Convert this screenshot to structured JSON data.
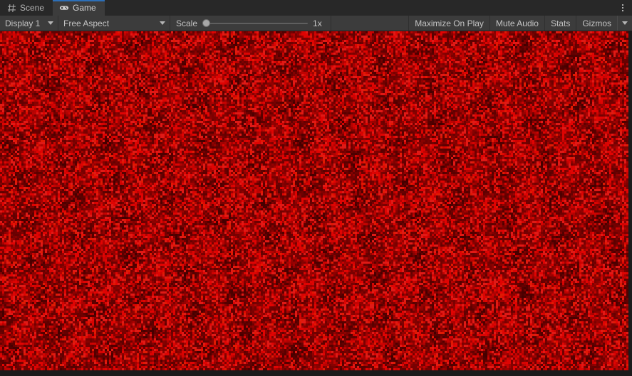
{
  "window": {
    "title": "Game",
    "menu_icon": "kebab-menu-icon"
  },
  "tabs": [
    {
      "label": "Scene",
      "icon": "scene-grid-icon",
      "active": false
    },
    {
      "label": "Game",
      "icon": "gamepad-icon",
      "active": true
    }
  ],
  "toolbar": {
    "display_dropdown": {
      "label": "Display 1",
      "icon": "chevron-down-icon"
    },
    "aspect_dropdown": {
      "label": "Free Aspect",
      "icon": "chevron-down-icon"
    },
    "scale": {
      "label": "Scale",
      "value": "1x",
      "slider_position_percent": 0
    },
    "maximize_on_play": "Maximize On Play",
    "mute_audio": "Mute Audio",
    "stats": "Stats",
    "gizmos": "Gizmos",
    "gizmos_dropdown_icon": "chevron-down-icon"
  },
  "game_view": {
    "render_base_color": "#cc0000",
    "render_noise_description": "red static noise",
    "render_width": 882,
    "render_height": 477
  },
  "colors": {
    "tab_bar_background": "#282828",
    "tab_active_background": "#3c3c3c",
    "tab_active_accent": "#2c6fb8",
    "toolbar_background": "#3c3c3c",
    "toolbar_text": "#c4c4c4",
    "separator": "#2f2f2f",
    "window_background": "#1b1b1b",
    "game_red": "#cc0000"
  }
}
